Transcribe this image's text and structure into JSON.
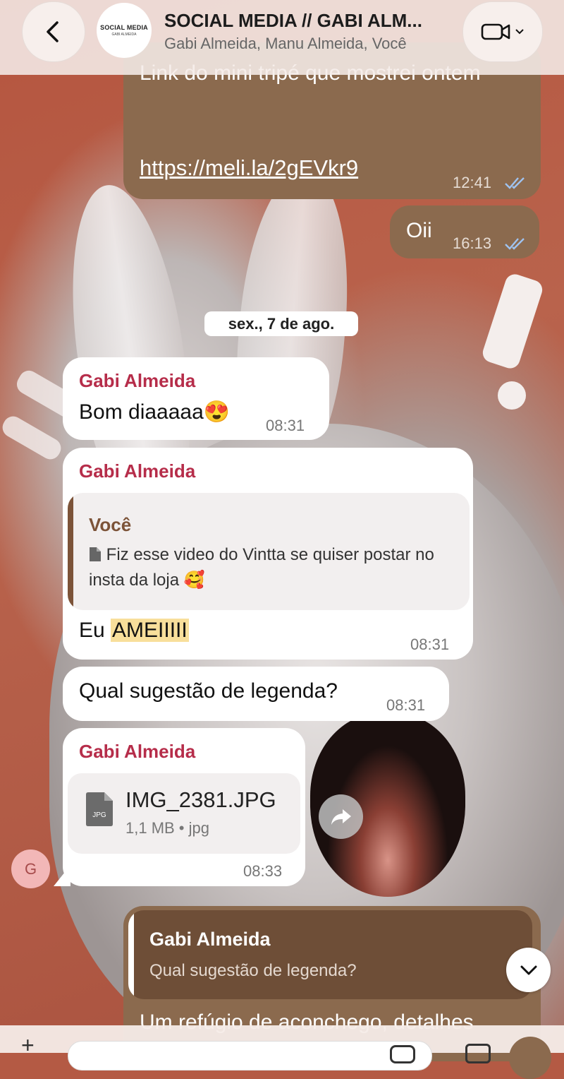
{
  "header": {
    "back_icon": "chevron-left-icon",
    "avatar_line1": "SOCIAL MEDIA",
    "avatar_line2": "GABI ALMEIDA",
    "title": "SOCIAL MEDIA // GABI ALM...",
    "members": "Gabi Almeida, Manu Almeida, Você",
    "video_icon": "video-camera-icon"
  },
  "messages": [
    {
      "direction": "out",
      "text": "Link do mini tripé que mostrei ontem",
      "link": "https://meli.la/2gEVkr9",
      "time": "12:41",
      "status": "read"
    },
    {
      "direction": "out",
      "text": "Oii",
      "time": "16:13",
      "status": "read"
    }
  ],
  "date_separator": "sex., 7 de ago.",
  "incoming": [
    {
      "sender": "Gabi Almeida",
      "text": "Bom diaaaaa",
      "emoji": "😍",
      "time": "08:31"
    },
    {
      "sender": "Gabi Almeida",
      "quote_sender": "Você",
      "quote_text": "Fiz esse video do Vintta se quiser postar no insta da loja 🥰",
      "text_prefix": "Eu",
      "text_highlight": "AMEIIIII",
      "time": "08:31"
    },
    {
      "text": "Qual sugestão de legenda?",
      "time": "08:31"
    },
    {
      "sender": "Gabi Almeida",
      "file_badge": "JPG",
      "file_name": "IMG_2381.JPG",
      "file_meta": "1,1 MB • jpg",
      "time": "08:33"
    }
  ],
  "sender_avatar_initial": "G",
  "reply": {
    "quote_sender": "Gabi Almeida",
    "quote_text": "Qual sugestão de legenda?",
    "text": "Um refúgio de aconchego, detalhes"
  },
  "colors": {
    "outgoing_bubble": "#8b6a4e",
    "incoming_bubble": "#ffffff",
    "sender_name": "#b62d4a",
    "quote_accent": "#7c5338",
    "highlight": "#f8df9b",
    "read_ticks": "#9fc3f0"
  }
}
